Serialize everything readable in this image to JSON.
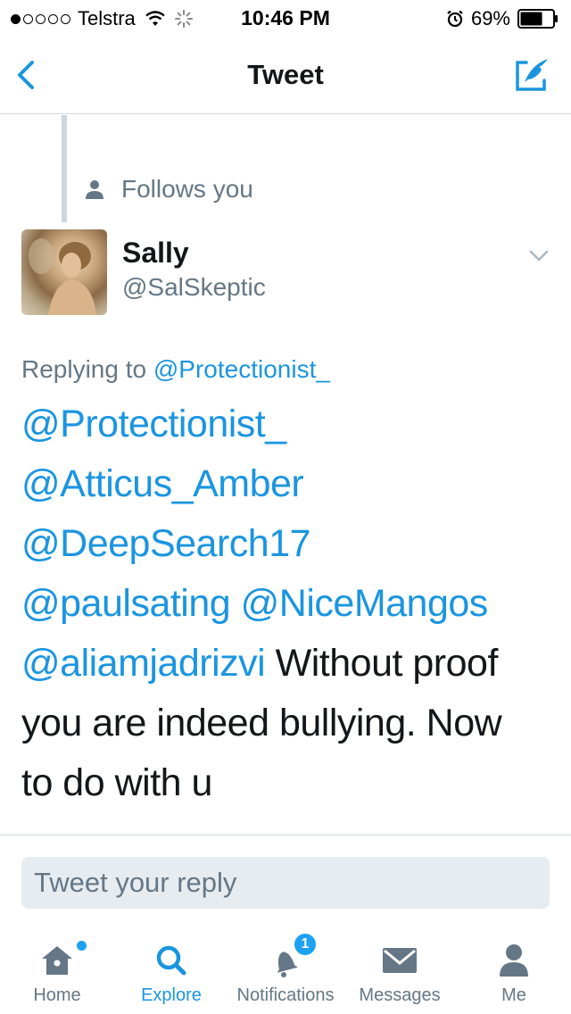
{
  "status_bar": {
    "carrier": "Telstra",
    "time": "10:46 PM",
    "battery": "69%",
    "battery_level": 0.69,
    "signal_bars_filled": 1,
    "signal_bars_total": 5
  },
  "nav": {
    "title": "Tweet",
    "back_icon": "chevron-left-icon",
    "compose_icon": "compose-tweet-icon"
  },
  "tweet": {
    "follows_label": "Follows you",
    "display_name": "Sally",
    "handle": "@SalSkeptic",
    "replying_prefix": "Replying to",
    "replying_to": "@Protectionist_",
    "body": {
      "mention1": "@Protectionist_",
      "mention2": "@Atticus_Amber",
      "mention3": "@DeepSearch17",
      "mention4": "@paulsating",
      "mention5": "@NiceMangos",
      "mention6": "@aliamjadrizvi",
      "text1": "Without proof",
      "text2": "you are indeed bullying. Now",
      "text3": "to do with u"
    }
  },
  "reply": {
    "placeholder": "Tweet your reply"
  },
  "tabs": {
    "home": "Home",
    "explore": "Explore",
    "notifications": "Notifications",
    "notifications_badge": "1",
    "messages": "Messages",
    "me": "Me"
  },
  "colors": {
    "accent": "#1b95e0",
    "secondary_text": "#657786",
    "badge": "#1da1f2"
  }
}
